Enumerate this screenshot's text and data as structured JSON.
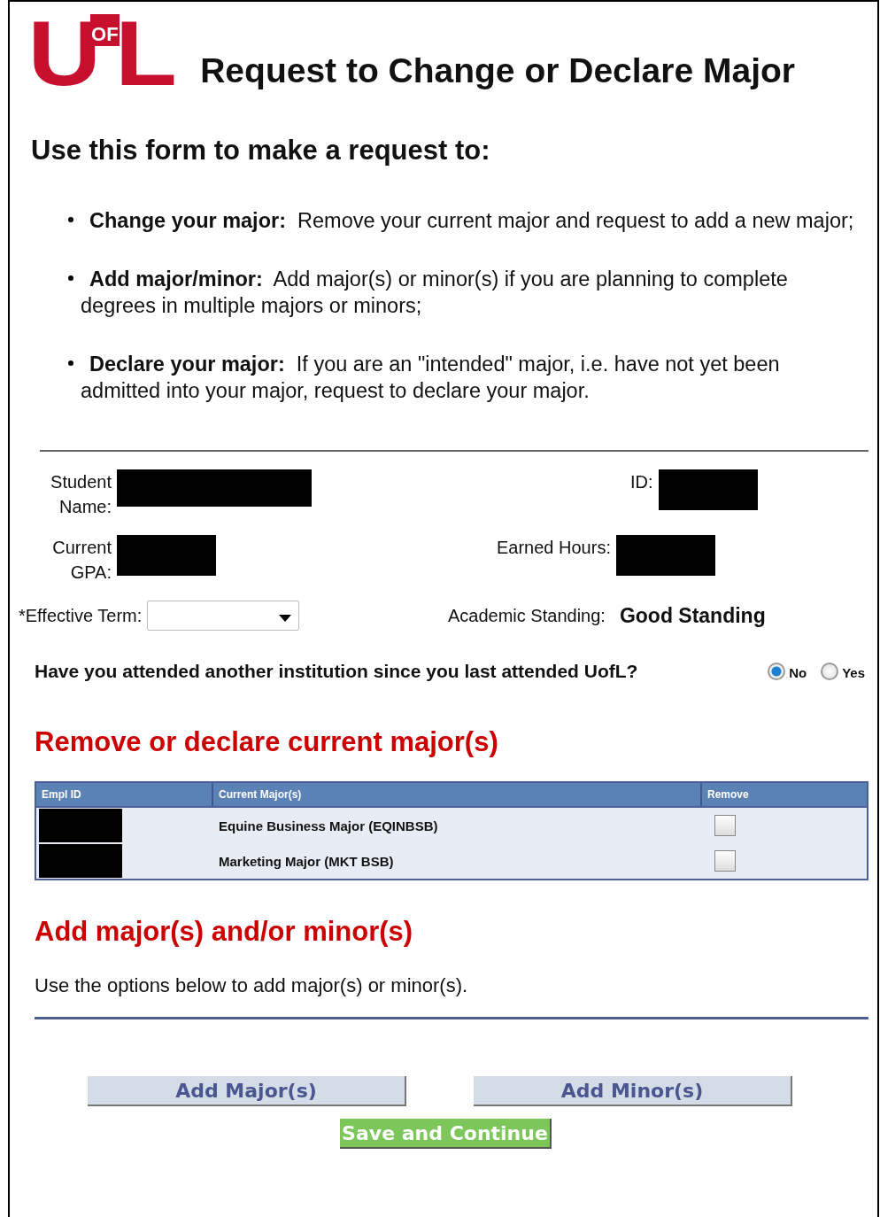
{
  "logo": {
    "letters": [
      "U",
      "OF",
      "L"
    ]
  },
  "title": "Request to Change or Declare Major",
  "intro_heading": "Use this form to make a request to:",
  "bullets": [
    {
      "lead": "Change your major:",
      "text": "Remove your current major and request to add a new major;"
    },
    {
      "lead": "Add major/minor:",
      "text": "Add major(s) or minor(s) if you are planning to complete degrees in multiple majors or minors;"
    },
    {
      "lead": "Declare your major:",
      "text": "If you are an \"intended\" major, i.e. have not yet been admitted into your major, request to declare your major."
    }
  ],
  "fields": [
    {
      "label": "Student Name:",
      "value_redacted": true
    },
    {
      "label": "ID:",
      "value_redacted": true
    },
    {
      "label": "Current GPA:",
      "value_redacted": true
    },
    {
      "label": "Earned Hours:",
      "value_redacted": true
    }
  ],
  "effective_term": {
    "label": "*Effective Term:"
  },
  "academic_standing": {
    "label": "Academic Standing:",
    "value": "Good Standing"
  },
  "question": {
    "text": "Have you attended another institution since you last attended UofL?",
    "options": [
      {
        "label": "No",
        "selected": true
      },
      {
        "label": "Yes",
        "selected": false
      }
    ]
  },
  "remove_section": {
    "heading": "Remove or declare current major(s)",
    "columns": [
      "Empl ID",
      "Current Major(s)",
      "Remove"
    ],
    "rows": [
      {
        "empl_id_redacted": true,
        "major": "Equine Business Major (EQINBSB)",
        "remove": false
      },
      {
        "empl_id_redacted": true,
        "major": "Marketing Major (MKT BSB)",
        "remove": false
      }
    ]
  },
  "add_section": {
    "heading": "Add major(s) and/or minor(s)",
    "text": "Use the options below to add major(s) or minor(s)."
  },
  "buttons": [
    {
      "label": "Add Major(s)"
    },
    {
      "label": "Add Minor(s)"
    }
  ],
  "save_button": {
    "label": "Save and Continue"
  }
}
